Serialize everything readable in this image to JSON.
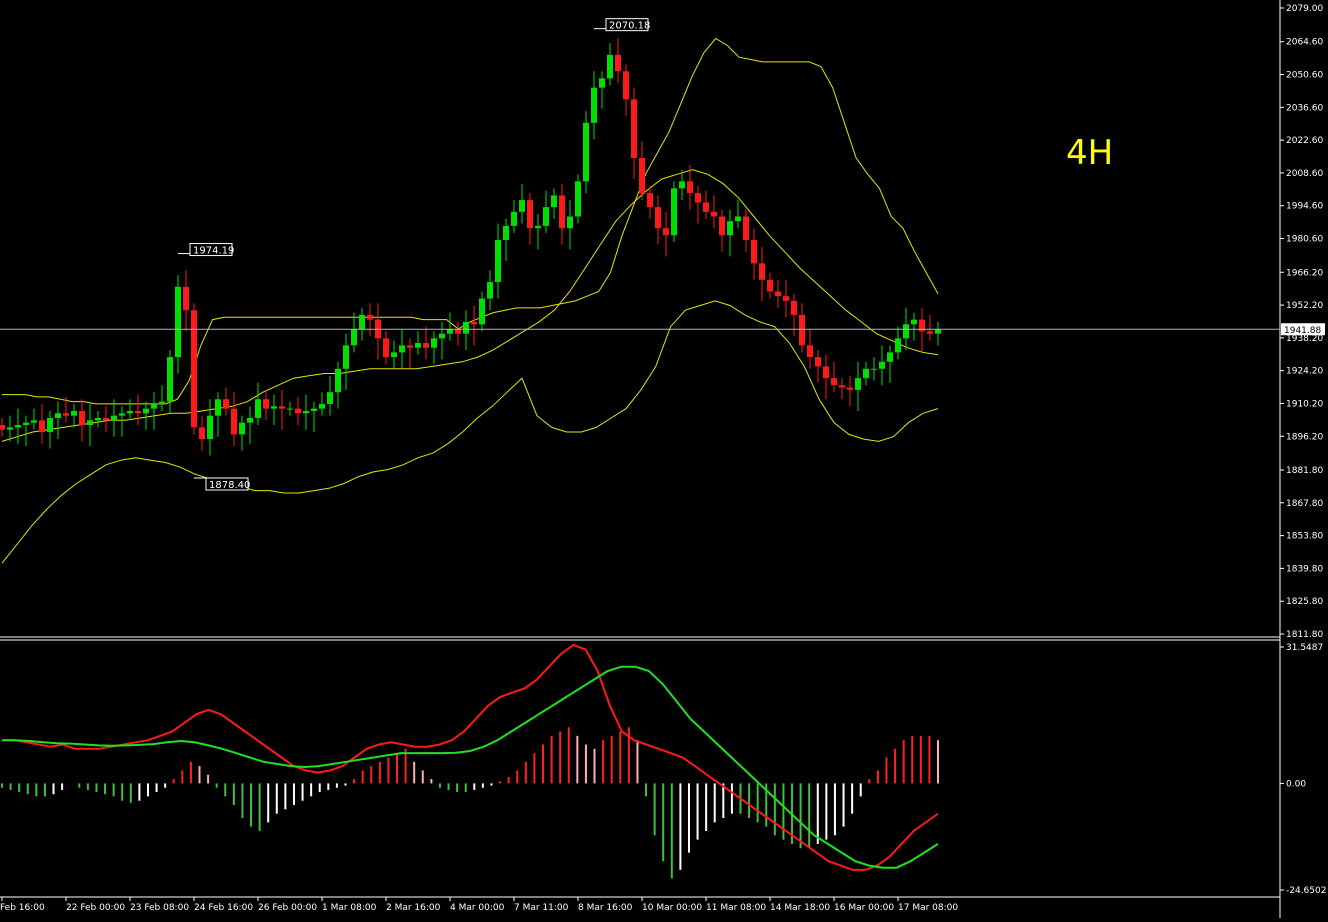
{
  "chart_data": [
    {
      "type": "candlestick",
      "panel": "price",
      "timeframe_label": "4H",
      "y_ticks": [
        "2079.00",
        "2064.60",
        "2050.60",
        "2036.60",
        "2022.60",
        "2008.60",
        "1994.60",
        "1980.60",
        "1966.20",
        "1952.20",
        "1938.20",
        "1924.20",
        "1910.20",
        "1896.20",
        "1881.80",
        "1867.80",
        "1853.80",
        "1839.80",
        "1825.80",
        "1811.80"
      ],
      "ylim": [
        1811.8,
        2079.0
      ],
      "current_price": "1941.88",
      "current_price_value": 1941.88,
      "annotations": [
        {
          "text": "2070.18",
          "bar": 74,
          "value": 2070.18
        },
        {
          "text": "1974.19",
          "bar": 22,
          "value": 1974.19
        },
        {
          "text": "1878.40",
          "bar": 24,
          "value": 1878.4
        }
      ],
      "x_labels": [
        {
          "text": "Feb 16:00",
          "bar": 1
        },
        {
          "text": "22 Feb 00:00",
          "bar": 9
        },
        {
          "text": "23 Feb 08:00",
          "bar": 17
        },
        {
          "text": "24 Feb 16:00",
          "bar": 25
        },
        {
          "text": "26 Feb 00:00",
          "bar": 33
        },
        {
          "text": "1 Mar 08:00",
          "bar": 41
        },
        {
          "text": "2 Mar 16:00",
          "bar": 49
        },
        {
          "text": "4 Mar 00:00",
          "bar": 57
        },
        {
          "text": "7 Mar 11:00",
          "bar": 65
        },
        {
          "text": "8 Mar 16:00",
          "bar": 73
        },
        {
          "text": "10 Mar 00:00",
          "bar": 81
        },
        {
          "text": "11 Mar 08:00",
          "bar": 89
        },
        {
          "text": "14 Mar 18:00",
          "bar": 97
        },
        {
          "text": "16 Mar 00:00",
          "bar": 105
        },
        {
          "text": "17 Mar 08:00",
          "bar": 113
        }
      ],
      "close_values": [
        1899,
        1900,
        1901,
        1902,
        1903,
        1898,
        1904,
        1906,
        1905,
        1907,
        1901,
        1903,
        1904,
        1903,
        1905,
        1906,
        1907,
        1906,
        1908,
        1910,
        1911,
        1930,
        1960,
        1950,
        1900,
        1895,
        1905,
        1912,
        1908,
        1897,
        1902,
        1904,
        1912,
        1908,
        1909,
        1908,
        1908,
        1906,
        1907,
        1908,
        1910,
        1915,
        1925,
        1935,
        1942,
        1948,
        1946,
        1938,
        1930,
        1932,
        1935,
        1934,
        1936,
        1934,
        1938,
        1940,
        1942,
        1940,
        1945,
        1944,
        1955,
        1962,
        1980,
        1986,
        1992,
        1997,
        1985,
        1986,
        1994,
        1999,
        1985,
        1990,
        2005,
        2030,
        2045,
        2049,
        2059,
        2052,
        2040,
        2015,
        2000,
        1994,
        1985,
        1982,
        2002,
        2005,
        2000,
        1996,
        1992,
        1990,
        1982,
        1988,
        1990,
        1980,
        1970,
        1963,
        1958,
        1956,
        1954,
        1948,
        1935,
        1930,
        1926,
        1921,
        1918,
        1917,
        1916,
        1921,
        1925,
        1925,
        1928,
        1932,
        1938,
        1944,
        1946,
        1941,
        1940,
        1942
      ],
      "bollinger": {
        "upper": [
          1914,
          1914,
          1914,
          1913,
          1913,
          1912,
          1911,
          1911,
          1910,
          1910,
          1910,
          1910,
          1910,
          1910,
          1910,
          1912,
          1920,
          1935,
          1946,
          1947,
          1947,
          1947,
          1947,
          1947,
          1947,
          1947,
          1947,
          1947,
          1947,
          1947,
          1947,
          1947,
          1947,
          1947,
          1947,
          1947,
          1946,
          1946,
          1946,
          1942,
          1945,
          1947,
          1949,
          1950,
          1951,
          1951,
          1951,
          1952,
          1953,
          1954,
          1956,
          1958,
          1966,
          1982,
          1995,
          2008,
          2017,
          2026,
          2038,
          2050,
          2060,
          2066,
          2063,
          2058,
          2057,
          2056,
          2056,
          2056,
          2056,
          2056,
          2054,
          2045,
          2030,
          2015,
          2008,
          2002,
          1990,
          1985,
          1975,
          1966,
          1957
        ],
        "middle": [
          1894,
          1896,
          1898,
          1899,
          1900,
          1901,
          1902,
          1903,
          1903,
          1904,
          1905,
          1906,
          1906,
          1907,
          1908,
          1909,
          1911,
          1915,
          1918,
          1921,
          1922,
          1923,
          1923,
          1924,
          1925,
          1925,
          1925,
          1925,
          1926,
          1927,
          1928,
          1930,
          1933,
          1937,
          1941,
          1945,
          1950,
          1958,
          1968,
          1978,
          1988,
          1995,
          2001,
          2006,
          2008,
          2010,
          2008,
          2004,
          1998,
          1990,
          1982,
          1975,
          1968,
          1962,
          1956,
          1950,
          1945,
          1940,
          1937,
          1934,
          1932,
          1931
        ],
        "lower": [
          1842,
          1850,
          1858,
          1865,
          1871,
          1876,
          1880,
          1884,
          1886,
          1887,
          1886,
          1885,
          1883,
          1880,
          1878,
          1876,
          1875,
          1873,
          1873,
          1872,
          1872,
          1873,
          1874,
          1876,
          1879,
          1881,
          1882,
          1884,
          1887,
          1889,
          1893,
          1898,
          1904,
          1909,
          1915,
          1921,
          1905,
          1900,
          1898,
          1898,
          1900,
          1904,
          1908,
          1916,
          1926,
          1943,
          1950,
          1952,
          1954,
          1952,
          1948,
          1945,
          1943,
          1936,
          1926,
          1912,
          1902,
          1897,
          1895,
          1894,
          1896,
          1902,
          1906,
          1908
        ]
      }
    },
    {
      "type": "macd",
      "panel": "indicator",
      "y_ticks": [
        "31.5487",
        "0.00",
        "-24.6502"
      ],
      "ylim": [
        -24.6502,
        31.5487
      ],
      "histogram": [
        -1,
        -1.5,
        -2,
        -2.5,
        -3,
        -3,
        -2.5,
        -1.5,
        0,
        -1,
        -1.5,
        -2,
        -2.5,
        -3,
        -4,
        -4.5,
        -4,
        -3,
        -2,
        -1,
        1,
        3,
        5,
        4,
        2,
        -1,
        -3,
        -5,
        -8,
        -10,
        -11,
        -9,
        -7,
        -6,
        -5,
        -4,
        -3,
        -2,
        -1.5,
        -1,
        -0.5,
        1,
        3,
        4,
        5,
        6,
        7,
        8,
        5,
        3,
        1,
        -1,
        -1.5,
        -2,
        -2,
        -1.5,
        -1,
        -0.5,
        0.5,
        1.5,
        3,
        5,
        7,
        9,
        11,
        12,
        13,
        11,
        9,
        8,
        10,
        11,
        12,
        13,
        10,
        -3,
        -12,
        -18,
        -22,
        -20,
        -16,
        -13,
        -11,
        -9,
        -8,
        -7,
        -7,
        -8,
        -9,
        -10,
        -12,
        -13,
        -14,
        -15,
        -15,
        -14,
        -13,
        -12,
        -10,
        -7,
        -3,
        1,
        3,
        6,
        8,
        10,
        11,
        11,
        11,
        10
      ],
      "macd_line": [
        10,
        10,
        9.5,
        9,
        8.5,
        9,
        8,
        8,
        8,
        8.5,
        9,
        9.5,
        10,
        11,
        12,
        14,
        16,
        17,
        16,
        14,
        12,
        10,
        8,
        6,
        4,
        3,
        2.5,
        3,
        4,
        6,
        8,
        9,
        9.5,
        9,
        8.5,
        8.5,
        9,
        10,
        12,
        15,
        18,
        20,
        21,
        22,
        24,
        27,
        30,
        32,
        31,
        26,
        18,
        12,
        10,
        9,
        8,
        7,
        6,
        4,
        2,
        0,
        -2,
        -4,
        -6,
        -8,
        -10,
        -12,
        -14,
        -16,
        -18,
        -19,
        -20,
        -20,
        -19,
        -17,
        -14,
        -11,
        -9,
        -7
      ],
      "signal_line": [
        10,
        10,
        9.8,
        9.5,
        9.3,
        9.2,
        9,
        8.8,
        8.7,
        8.8,
        8.9,
        9.1,
        9.5,
        9.8,
        9.5,
        8.8,
        8,
        7,
        6,
        5,
        4.5,
        4,
        3.8,
        4,
        4.5,
        5,
        5.5,
        6,
        6.5,
        7,
        7,
        7,
        7,
        7.1,
        7.5,
        8.5,
        10,
        12,
        14,
        16,
        18,
        20,
        22,
        24,
        26,
        27,
        27,
        26,
        23,
        19,
        15,
        12,
        9,
        6,
        3,
        0,
        -3,
        -6,
        -9,
        -12,
        -14,
        -16,
        -18,
        -19,
        -19.5,
        -19.5,
        -18,
        -16,
        -14
      ]
    }
  ]
}
